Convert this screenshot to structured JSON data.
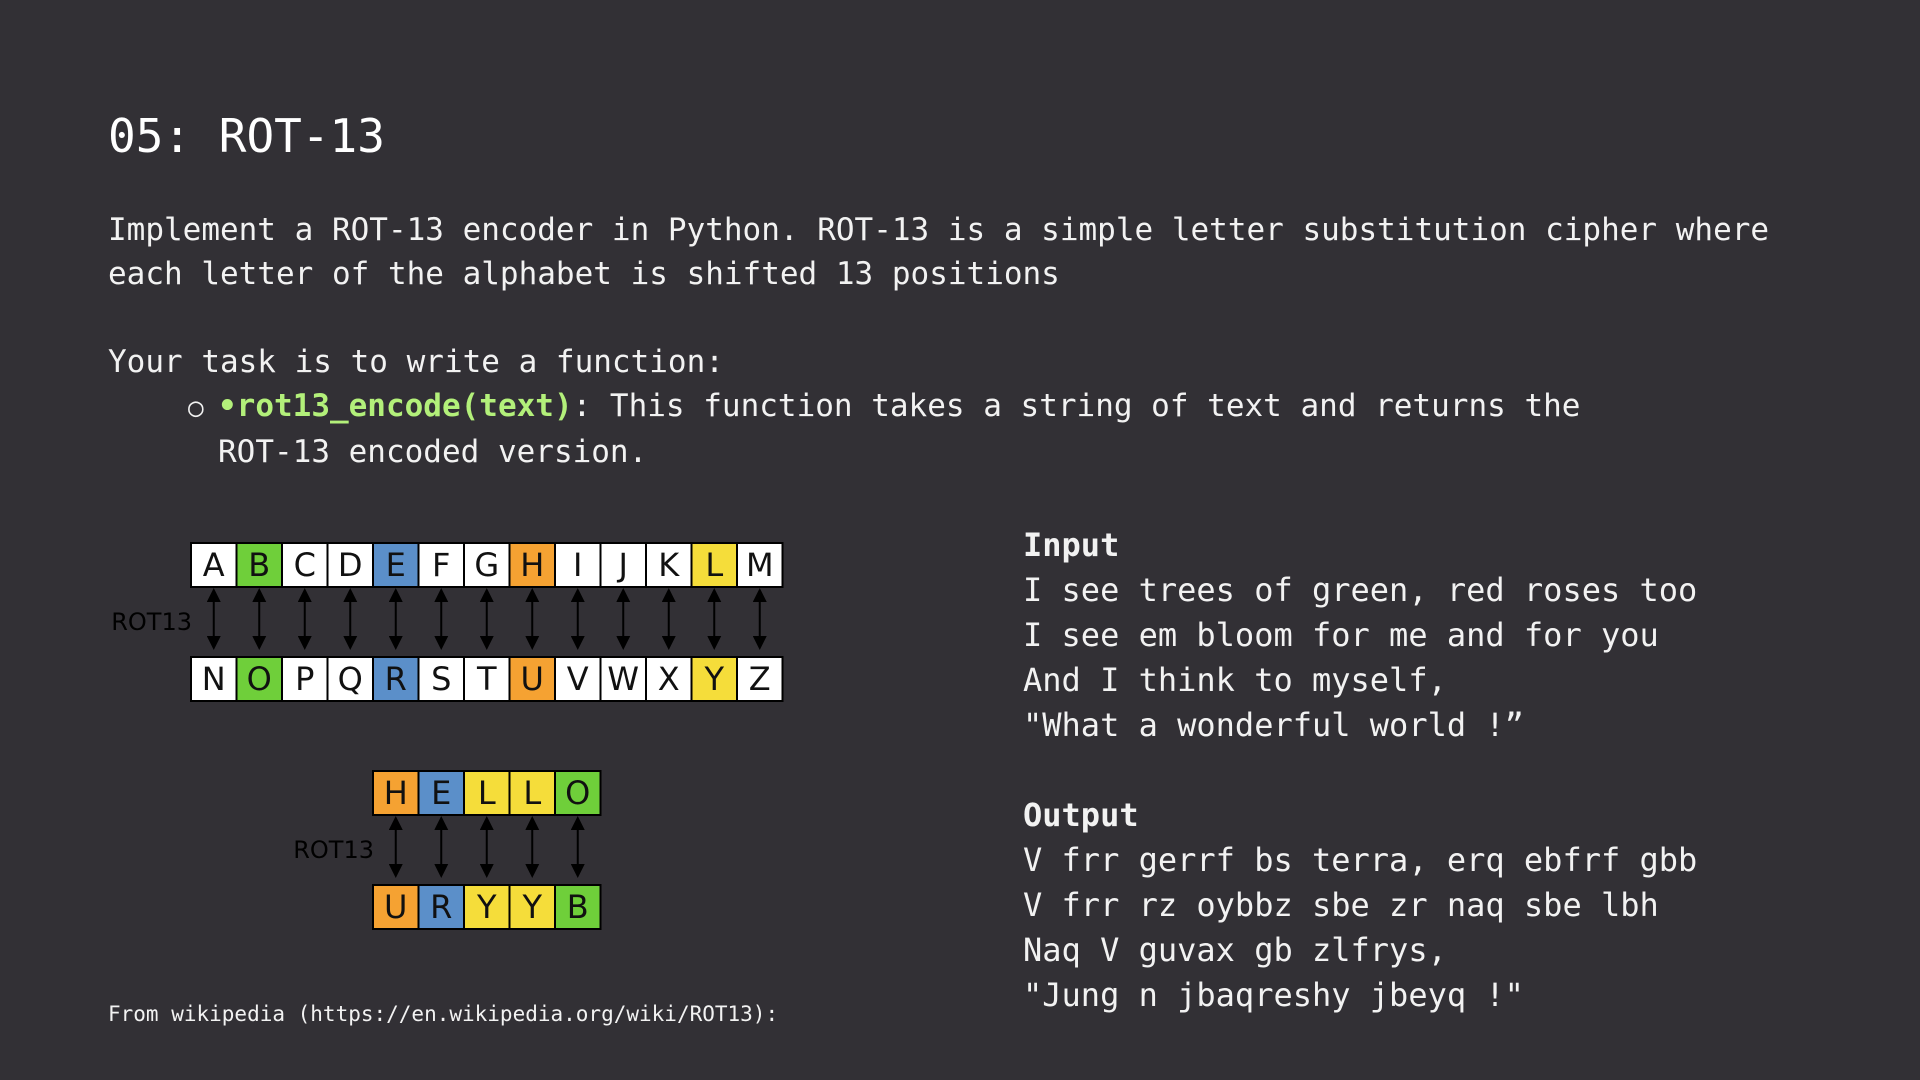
{
  "slide": {
    "title": "05: ROT-13",
    "intro": "Implement a ROT-13 encoder in Python. ROT-13 is a simple letter substitution cipher where each letter of the alphabet is shifted 13 positions",
    "task_intro": "Your task is to write a function:",
    "task_bullet": "○",
    "task_fn": "•rot13_encode(text)",
    "task_desc_1": ": This function takes a string of text and returns the",
    "task_desc_2": "ROT-13 encoded version.",
    "footer": "From wikipedia (https://en.wikipedia.org/wiki/ROT13):"
  },
  "colors": {
    "background": "#323035",
    "green": "#6fcf3a",
    "blue": "#5b8fc9",
    "orange": "#f5a232",
    "yellow": "#f5dd3a",
    "white": "#ffffff",
    "function_name": "#b3f07a"
  },
  "diagram": {
    "label": "ROT13",
    "top_row": [
      {
        "letter": "A",
        "color": "white"
      },
      {
        "letter": "B",
        "color": "green"
      },
      {
        "letter": "C",
        "color": "white"
      },
      {
        "letter": "D",
        "color": "white"
      },
      {
        "letter": "E",
        "color": "blue"
      },
      {
        "letter": "F",
        "color": "white"
      },
      {
        "letter": "G",
        "color": "white"
      },
      {
        "letter": "H",
        "color": "orange"
      },
      {
        "letter": "I",
        "color": "white"
      },
      {
        "letter": "J",
        "color": "white"
      },
      {
        "letter": "K",
        "color": "white"
      },
      {
        "letter": "L",
        "color": "yellow"
      },
      {
        "letter": "M",
        "color": "white"
      }
    ],
    "bottom_row": [
      {
        "letter": "N",
        "color": "white"
      },
      {
        "letter": "O",
        "color": "green"
      },
      {
        "letter": "P",
        "color": "white"
      },
      {
        "letter": "Q",
        "color": "white"
      },
      {
        "letter": "R",
        "color": "blue"
      },
      {
        "letter": "S",
        "color": "white"
      },
      {
        "letter": "T",
        "color": "white"
      },
      {
        "letter": "U",
        "color": "orange"
      },
      {
        "letter": "V",
        "color": "white"
      },
      {
        "letter": "W",
        "color": "white"
      },
      {
        "letter": "X",
        "color": "white"
      },
      {
        "letter": "Y",
        "color": "yellow"
      },
      {
        "letter": "Z",
        "color": "white"
      }
    ],
    "hello_top": [
      {
        "letter": "H",
        "color": "orange"
      },
      {
        "letter": "E",
        "color": "blue"
      },
      {
        "letter": "L",
        "color": "yellow"
      },
      {
        "letter": "L",
        "color": "yellow"
      },
      {
        "letter": "O",
        "color": "green"
      }
    ],
    "hello_bottom": [
      {
        "letter": "U",
        "color": "orange"
      },
      {
        "letter": "R",
        "color": "blue"
      },
      {
        "letter": "Y",
        "color": "yellow"
      },
      {
        "letter": "Y",
        "color": "yellow"
      },
      {
        "letter": "B",
        "color": "green"
      }
    ]
  },
  "input": {
    "heading": "Input",
    "lines": [
      "I see trees of green, red roses too",
      "I see em bloom for me and for you",
      "And I think to myself,",
      "\"What a wonderful world !”"
    ]
  },
  "output": {
    "heading": "Output",
    "lines": [
      "V frr gerrf bs terra, erq ebfrf gbb",
      "V frr rz oybbz sbe zr naq sbe lbh",
      "Naq V guvax gb zlfrys,",
      "\"Jung n jbaqreshy jbeyq !\""
    ]
  }
}
